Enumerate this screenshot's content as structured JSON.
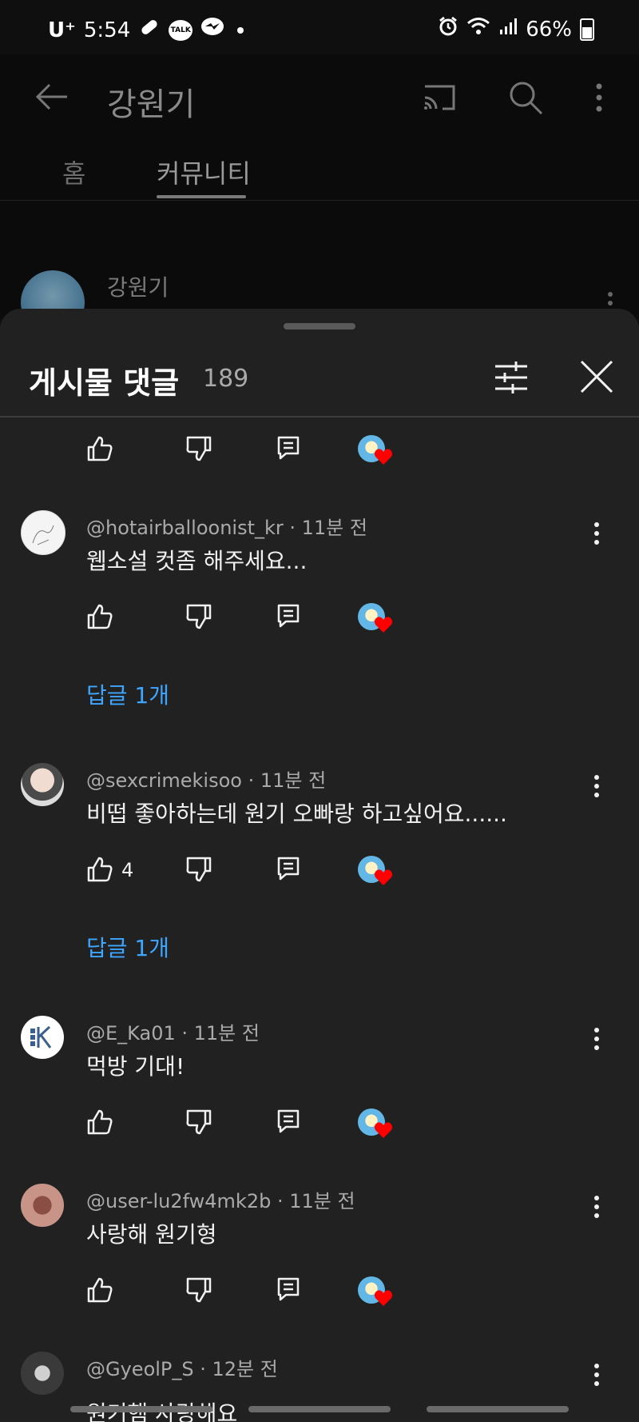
{
  "status_bar": {
    "carrier": "U⁺",
    "time": "5:54",
    "talk_label": "TALK",
    "battery": "66%"
  },
  "background_app": {
    "channel_title": "강원기",
    "tabs": [
      {
        "label": "홈",
        "selected": false
      },
      {
        "label": "커뮤니티",
        "selected": true
      }
    ],
    "post_author": "강원기"
  },
  "comments_sheet": {
    "title": "게시물 댓글",
    "count": "189",
    "comments": [
      {
        "author": "@hotairballoonist_kr",
        "time": "11분 전",
        "text": "웹소설 컷좀 해주세요...",
        "likes": "",
        "replies_label": "답글 1개",
        "avatar_color": "#f4f4f4"
      },
      {
        "author": "@sexcrimekisoo",
        "time": "11분 전",
        "text": "비떱 좋아하는데 원기 오빠랑 하고싶어요......",
        "likes": "4",
        "replies_label": "답글 1개",
        "avatar_color": "#d9c8c0"
      },
      {
        "author": "@E_Ka01",
        "time": "11분 전",
        "text": "먹방 기대!",
        "likes": "",
        "replies_label": "",
        "avatar_color": "#ffffff"
      },
      {
        "author": "@user-lu2fw4mk2b",
        "time": "11분 전",
        "text": "사랑해 원기형",
        "likes": "",
        "replies_label": "",
        "avatar_color": "#c89488"
      },
      {
        "author": "@GyeolP_S",
        "time": "12분 전",
        "text": "원기햄 사랑해요",
        "likes": "",
        "replies_label": "",
        "avatar_color": "#3a3a3a"
      }
    ]
  },
  "colors": {
    "background": "#0f0f0f",
    "sheet": "#212121",
    "link_blue": "#3ea6ff",
    "heart_red": "#ff0000"
  },
  "icons": [
    "back-arrow-icon",
    "cast-icon",
    "search-icon",
    "more-vert-icon",
    "filter-sliders-icon",
    "close-icon",
    "thumb-up-icon",
    "thumb-down-icon",
    "reply-comment-icon",
    "creator-heart-icon"
  ]
}
